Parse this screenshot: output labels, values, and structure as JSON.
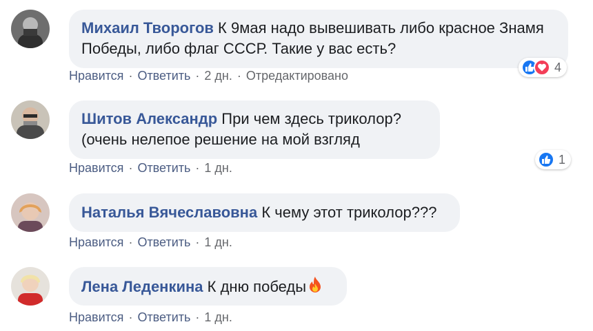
{
  "colors": {
    "author": "#385898",
    "bubble": "#f0f2f5",
    "like": "#1877f2",
    "love": "#f33e58"
  },
  "actions": {
    "like": "Нравится",
    "reply": "Ответить",
    "separator": "·"
  },
  "comments": [
    {
      "author": "Михаил Творогов",
      "text": "К 9мая надо вывешивать либо красное Знамя Победы, либо флаг СССР. Такие у вас есть?",
      "time": "2 дн.",
      "edited": "Отредактировано",
      "reactions": {
        "icons": [
          "like-icon",
          "love-icon"
        ],
        "count": "4"
      }
    },
    {
      "author": "Шитов Александр",
      "text": "При чем здесь триколор?(очень нелепое решение на мой взгляд",
      "time": "1 дн.",
      "reactions": {
        "icons": [
          "like-icon"
        ],
        "count": "1"
      }
    },
    {
      "author": "Наталья Вячеславовна",
      "text": "К чему этот триколор???",
      "time": "1 дн."
    },
    {
      "author": "Лена Леденкина",
      "text": "К дню победы",
      "emoji": "fire-emoji",
      "time": "1 дн."
    }
  ]
}
